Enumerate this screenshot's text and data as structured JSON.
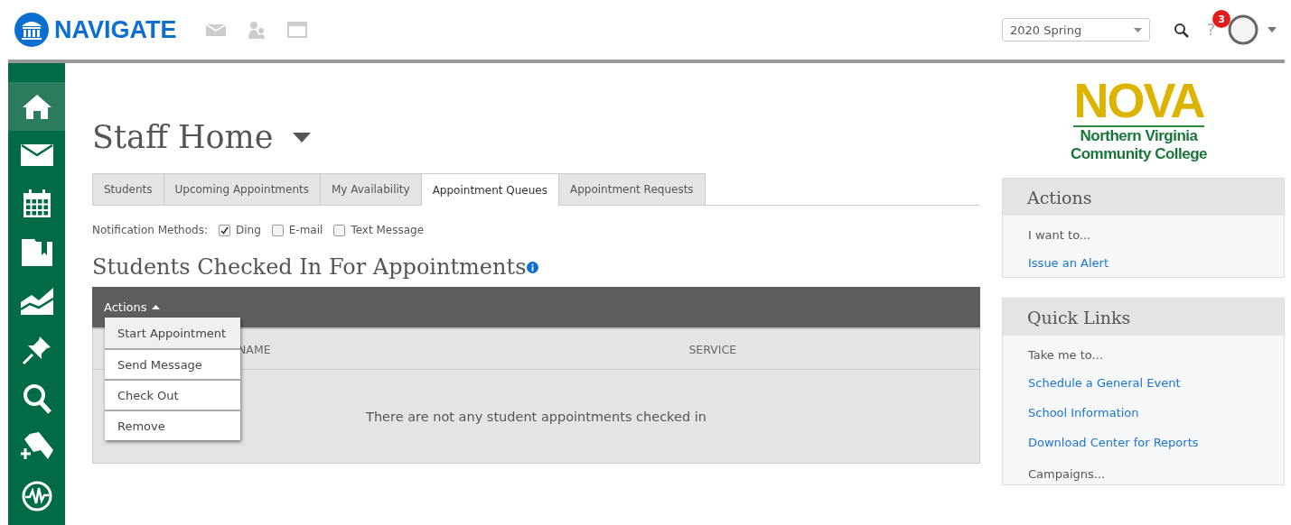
{
  "header": {
    "brand": "NAVIGATE",
    "term_select": {
      "value": "2020 Spring"
    },
    "help": {
      "label": "?",
      "badge": "3"
    }
  },
  "sidebar": {
    "items": [
      {
        "kind": "home",
        "selected": true
      },
      {
        "kind": "mail",
        "selected": false
      },
      {
        "kind": "calendar",
        "selected": false
      },
      {
        "kind": "folder",
        "selected": false
      },
      {
        "kind": "chart",
        "selected": false
      },
      {
        "kind": "pin",
        "selected": false
      },
      {
        "kind": "search",
        "selected": false
      },
      {
        "kind": "bookmark",
        "selected": false
      },
      {
        "kind": "pulse",
        "selected": false
      }
    ]
  },
  "page": {
    "title": "Staff Home",
    "tabs": [
      {
        "label": "Students",
        "selected": false
      },
      {
        "label": "Upcoming Appointments",
        "selected": false
      },
      {
        "label": "My Availability",
        "selected": false
      },
      {
        "label": "Appointment Queues",
        "selected": true
      },
      {
        "label": "Appointment Requests",
        "selected": false
      }
    ],
    "notification": {
      "label": "Notification Methods:",
      "options": [
        {
          "label": "Ding",
          "checked": true
        },
        {
          "label": "E-mail",
          "checked": false
        },
        {
          "label": "Text Message",
          "checked": false
        }
      ]
    },
    "section_title": "Students Checked In For Appointments",
    "table": {
      "actions_label": "Actions",
      "menu": [
        {
          "label": "Start Appointment",
          "selected": true
        },
        {
          "label": "Send Message",
          "selected": false
        },
        {
          "label": "Check Out",
          "selected": false
        },
        {
          "label": "Remove",
          "selected": false
        }
      ],
      "columns": [
        "NAME",
        "SERVICE"
      ],
      "empty_message": "There are not any student appointments checked in"
    }
  },
  "logo": {
    "name": "NOVA",
    "line_1": "Northern Virginia",
    "line_2": "Community College"
  },
  "panels": [
    {
      "title": "Actions",
      "prompt": "I want to...",
      "links": [
        "Issue an Alert"
      ]
    },
    {
      "title": "Quick Links",
      "prompt": "Take me to...",
      "links": [
        "Schedule a General Event",
        "School Information",
        "Download Center for Reports"
      ],
      "footer": "Campaigns..."
    }
  ]
}
